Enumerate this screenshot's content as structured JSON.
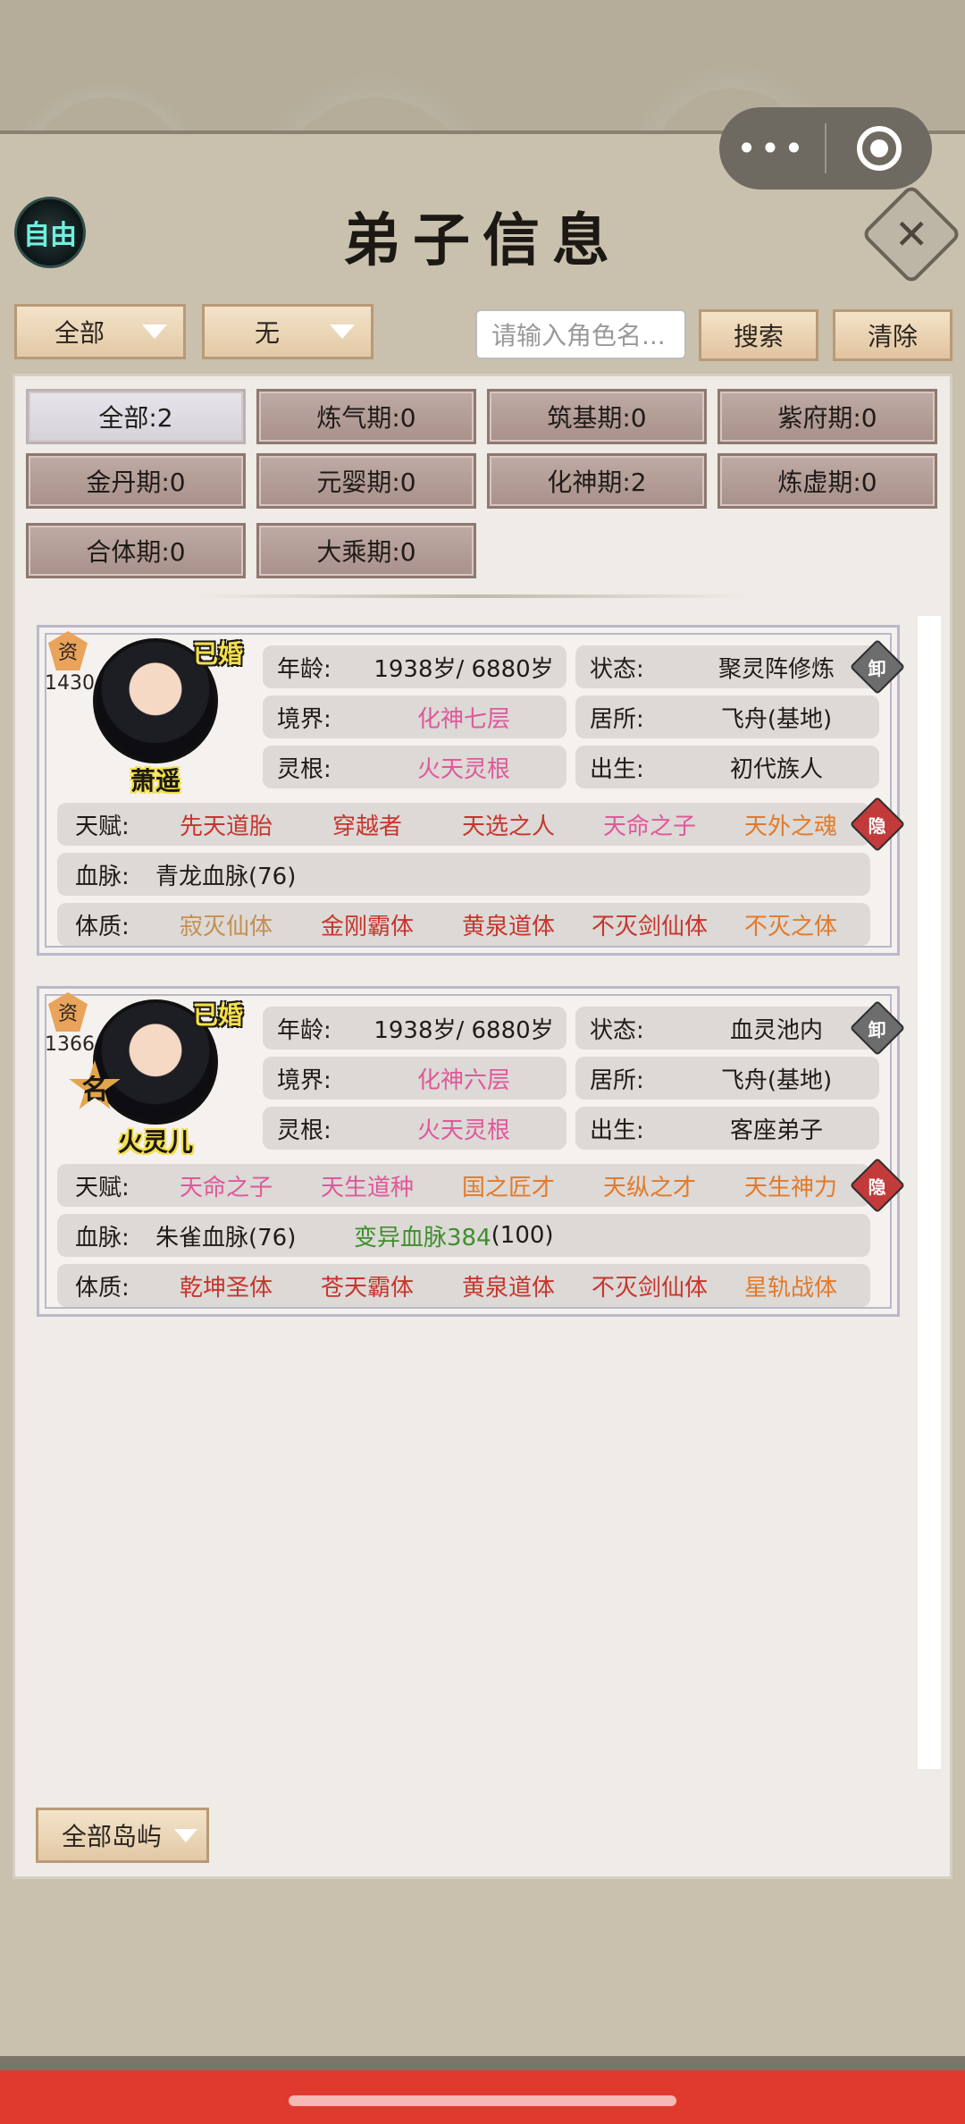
{
  "header": {
    "freedom_label": "自由",
    "title": "弟子信息",
    "close_icon": "close-icon"
  },
  "capsule": {
    "more_icon": "•••",
    "target_icon": "record-icon"
  },
  "filters": {
    "category": "全部",
    "second": "无",
    "search_placeholder": "请输入角色名...",
    "search_label": "搜索",
    "clear_label": "清除"
  },
  "realms": [
    {
      "label": "全部:2"
    },
    {
      "label": "炼气期:0"
    },
    {
      "label": "筑基期:0"
    },
    {
      "label": "紫府期:0"
    },
    {
      "label": "金丹期:0"
    },
    {
      "label": "元婴期:0"
    },
    {
      "label": "化神期:2"
    },
    {
      "label": "炼虚期:0"
    },
    {
      "label": "合体期:0"
    },
    {
      "label": "大乘期:0"
    }
  ],
  "labels": {
    "zi": "资",
    "age": "年龄:",
    "state": "状态:",
    "realm": "境界:",
    "residence": "居所:",
    "root": "灵根:",
    "birth": "出生:",
    "talent": "天赋:",
    "bloodline": "血脉:",
    "physique": "体质:",
    "unload": "卸",
    "hide": "隐",
    "married": "已婚",
    "ming": "名"
  },
  "disciples": [
    {
      "name": "萧遥",
      "aptitude": "1430",
      "age": "1938岁/ 6880岁",
      "state": "聚灵阵修炼",
      "realm": "化神七层",
      "residence": "飞舟(基地)",
      "root": "火天灵根",
      "birth": "初代族人",
      "talents": [
        "先天道胎",
        "穿越者",
        "天选之人",
        "天命之子",
        "天外之魂"
      ],
      "bloodline": "青龙血脉(76)",
      "physiques": [
        "寂灭仙体",
        "金刚霸体",
        "黄泉道体",
        "不灭剑仙体",
        "不灭之体"
      ]
    },
    {
      "name": "火灵儿",
      "aptitude": "1366",
      "age": "1938岁/ 6880岁",
      "state": "血灵池内",
      "realm": "化神六层",
      "residence": "飞舟(基地)",
      "root": "火天灵根",
      "birth": "客座弟子",
      "talents": [
        "天命之子",
        "天生道种",
        "国之匠才",
        "天纵之才",
        "天生神力"
      ],
      "bloodline": "朱雀血脉(76)",
      "bloodline2": "变异血脉384",
      "bloodline2_suffix": "(100)",
      "physiques": [
        "乾坤圣体",
        "苍天霸体",
        "黄泉道体",
        "不灭剑仙体",
        "星轨战体"
      ]
    }
  ],
  "footer": {
    "island_filter": "全部岛屿"
  }
}
